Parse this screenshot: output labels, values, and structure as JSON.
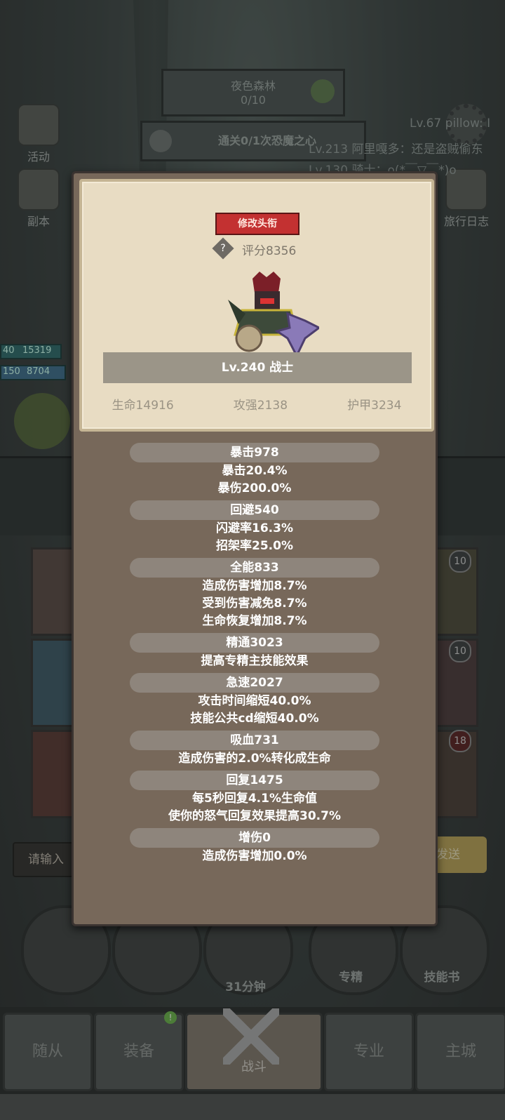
{
  "stage": {
    "name": "夜色森林",
    "progress": "0/10"
  },
  "quest": {
    "text": "通关0/1次恐魔之心"
  },
  "left_menu": [
    {
      "label": "活动"
    },
    {
      "label": "副本"
    }
  ],
  "right_menu": [
    {
      "label": "旅行日志"
    }
  ],
  "chat_lines": [
    "Lv.67 pillow: I",
    "Lv.213 阿里嘎多：还是盗贼偷东",
    "Lv.130 骑士：o(*￣▽￣*)o"
  ],
  "player_bars": {
    "hp": "15319",
    "mp": "8704",
    "hp_lv": "40",
    "mp_lv": "150"
  },
  "card": {
    "edit_title_button": "修改头衔",
    "score": "评分8356",
    "level_class": "Lv.240 战士",
    "stats": [
      {
        "label": "生命14916"
      },
      {
        "label": "攻强2138"
      },
      {
        "label": "护甲3234"
      }
    ]
  },
  "attributes": [
    {
      "title": "暴击978",
      "lines": [
        "暴击20.4%",
        "暴伤200.0%"
      ]
    },
    {
      "title": "回避540",
      "lines": [
        "闪避率16.3%",
        "招架率25.0%"
      ]
    },
    {
      "title": "全能833",
      "lines": [
        "造成伤害增加8.7%",
        "受到伤害减免8.7%",
        "生命恢复增加8.7%"
      ]
    },
    {
      "title": "精通3023",
      "lines": [
        "提高专精主技能效果"
      ]
    },
    {
      "title": "急速2027",
      "lines": [
        "攻击时间缩短40.0%",
        "技能公共cd缩短40.0%"
      ]
    },
    {
      "title": "吸血731",
      "lines": [
        "造成伤害的2.0%转化成生命"
      ]
    },
    {
      "title": "回复1475",
      "lines": [
        "每5秒回复4.1%生命值",
        "使你的怒气回复效果提高30.7%"
      ]
    },
    {
      "title": "增伤0",
      "lines": [
        "造成伤害增加0.0%"
      ]
    }
  ],
  "chat_input": {
    "placeholder": "请输入",
    "send": "发送"
  },
  "skill_badges": [
    "10",
    "10",
    "18"
  ],
  "action_buttons": {
    "chest_timer": "31分钟",
    "spec": "专精",
    "skill_book": "技能书"
  },
  "tabs": [
    {
      "label": "随从"
    },
    {
      "label": "装备"
    },
    {
      "label": "战斗"
    },
    {
      "label": "专业"
    },
    {
      "label": "主城"
    }
  ],
  "colors": {
    "panel": "#77685a",
    "card": "#e8dcc3",
    "title_button": "#c33131",
    "pill": "#8e857c"
  }
}
